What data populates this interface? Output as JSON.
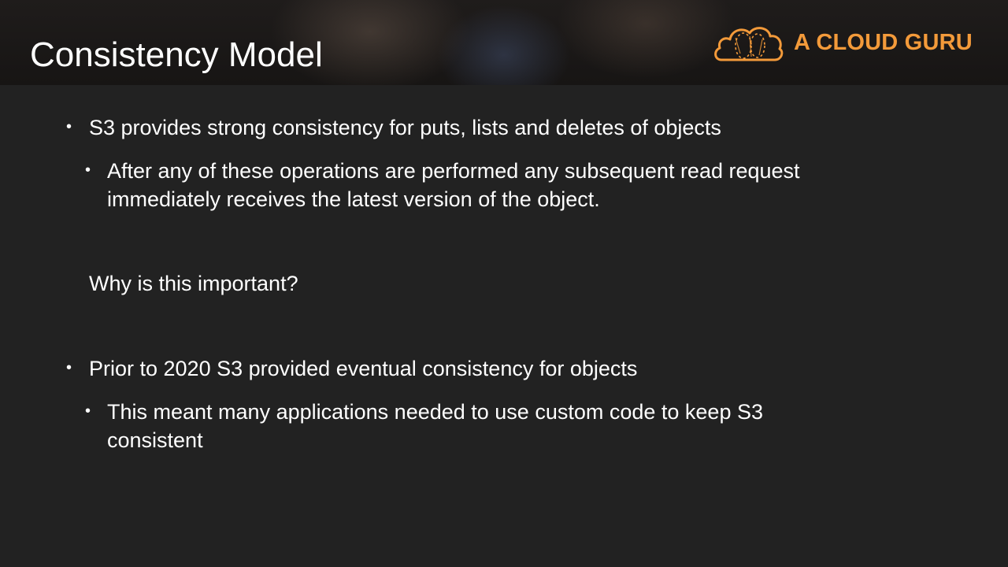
{
  "slide": {
    "title": "Consistency Model",
    "brand": "A CLOUD GURU",
    "accent_color": "#f39a3a",
    "bullet_glyph": "•",
    "points": [
      {
        "level": 1,
        "text": "S3 provides strong consistency for puts, lists and deletes of objects"
      },
      {
        "level": 2,
        "lines": [
          "After any of these operations are performed any subsequent read request",
          "immediately receives the latest version of the object."
        ]
      },
      {
        "level": 0,
        "text": "Why is this important?"
      },
      {
        "level": 1,
        "text": "Prior to 2020 S3 provided eventual consistency for objects"
      },
      {
        "level": 2,
        "lines": [
          "This meant many applications needed to use custom code to keep S3",
          "consistent"
        ]
      }
    ]
  }
}
